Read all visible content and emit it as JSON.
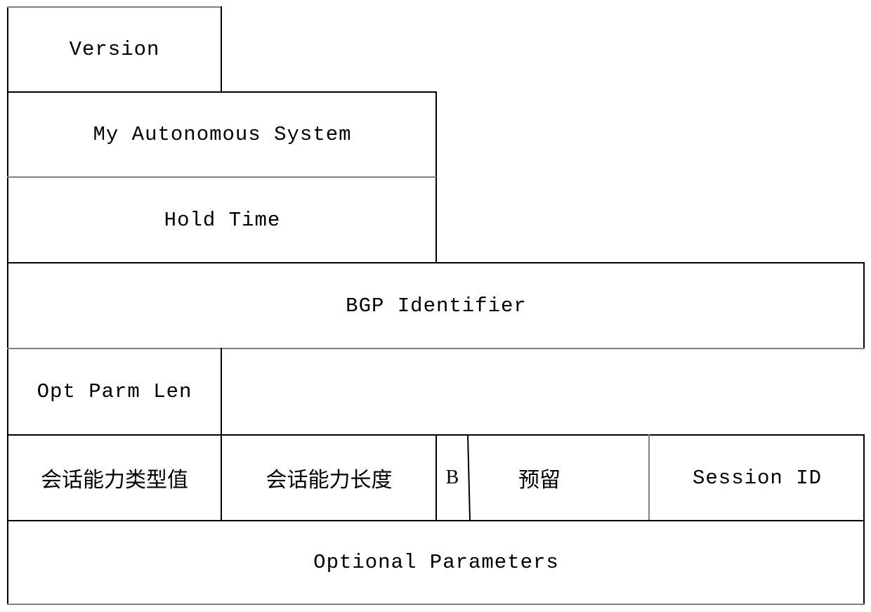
{
  "diagram": {
    "type": "packet-format",
    "rows": [
      {
        "fields": [
          {
            "id": "version",
            "label": "Version"
          }
        ]
      },
      {
        "fields": [
          {
            "id": "my-autonomous-system",
            "label": "My Autonomous System"
          }
        ]
      },
      {
        "fields": [
          {
            "id": "hold-time",
            "label": "Hold Time"
          }
        ]
      },
      {
        "fields": [
          {
            "id": "bgp-identifier",
            "label": "BGP Identifier"
          }
        ]
      },
      {
        "fields": [
          {
            "id": "opt-parm-len",
            "label": "Opt Parm Len"
          }
        ]
      },
      {
        "fields": [
          {
            "id": "capability-type-value",
            "label": "会话能力类型值"
          },
          {
            "id": "capability-length",
            "label": "会话能力长度"
          },
          {
            "id": "b-flag",
            "label": "B"
          },
          {
            "id": "reserved",
            "label": "预留"
          },
          {
            "id": "session-id",
            "label": "Session ID"
          }
        ]
      },
      {
        "fields": [
          {
            "id": "optional-parameters",
            "label": "Optional Parameters"
          }
        ]
      }
    ]
  }
}
